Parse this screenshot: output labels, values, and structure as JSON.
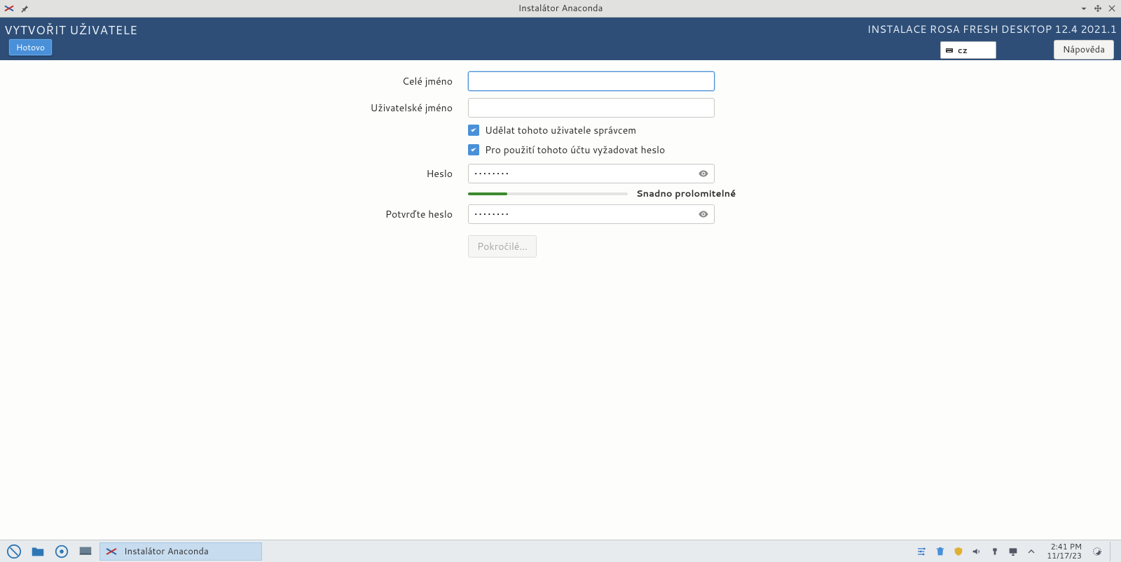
{
  "window": {
    "title": "Instalátor Anaconda",
    "pinned": true
  },
  "header": {
    "page_title": "VYTVOŘIT UŽIVATELE",
    "done_label": "Hotovo",
    "product": "INSTALACE ROSA FRESH DESKTOP 12.4 2021.1",
    "kb_layout": "cz",
    "help_label": "Nápověda"
  },
  "form": {
    "full_name_label": "Celé jméno",
    "full_name_value": "",
    "username_label": "Uživatelské jméno",
    "username_value": "",
    "admin_checked": true,
    "admin_label": "Udělat tohoto uživatele správcem",
    "require_pw_checked": true,
    "require_pw_label": "Pro použití tohoto účtu vyžadovat heslo",
    "password_label": "Heslo",
    "password_value": "••••••••",
    "confirm_label": "Potvrďte heslo",
    "confirm_value": "••••••••",
    "strength_pct": 25,
    "strength_label": "Snadno prolomitelné",
    "advanced_label": "Pokročilé…"
  },
  "icons": {
    "pin": "pin-icon",
    "min": "minimize-icon",
    "max": "maximize-icon",
    "close": "close-icon",
    "keyboard": "keyboard-icon",
    "check": "check-icon",
    "eye": "eye-icon"
  },
  "taskbar": {
    "task_title": "Instalátor Anaconda",
    "time": "2:41 PM",
    "date": "11/17/23"
  }
}
